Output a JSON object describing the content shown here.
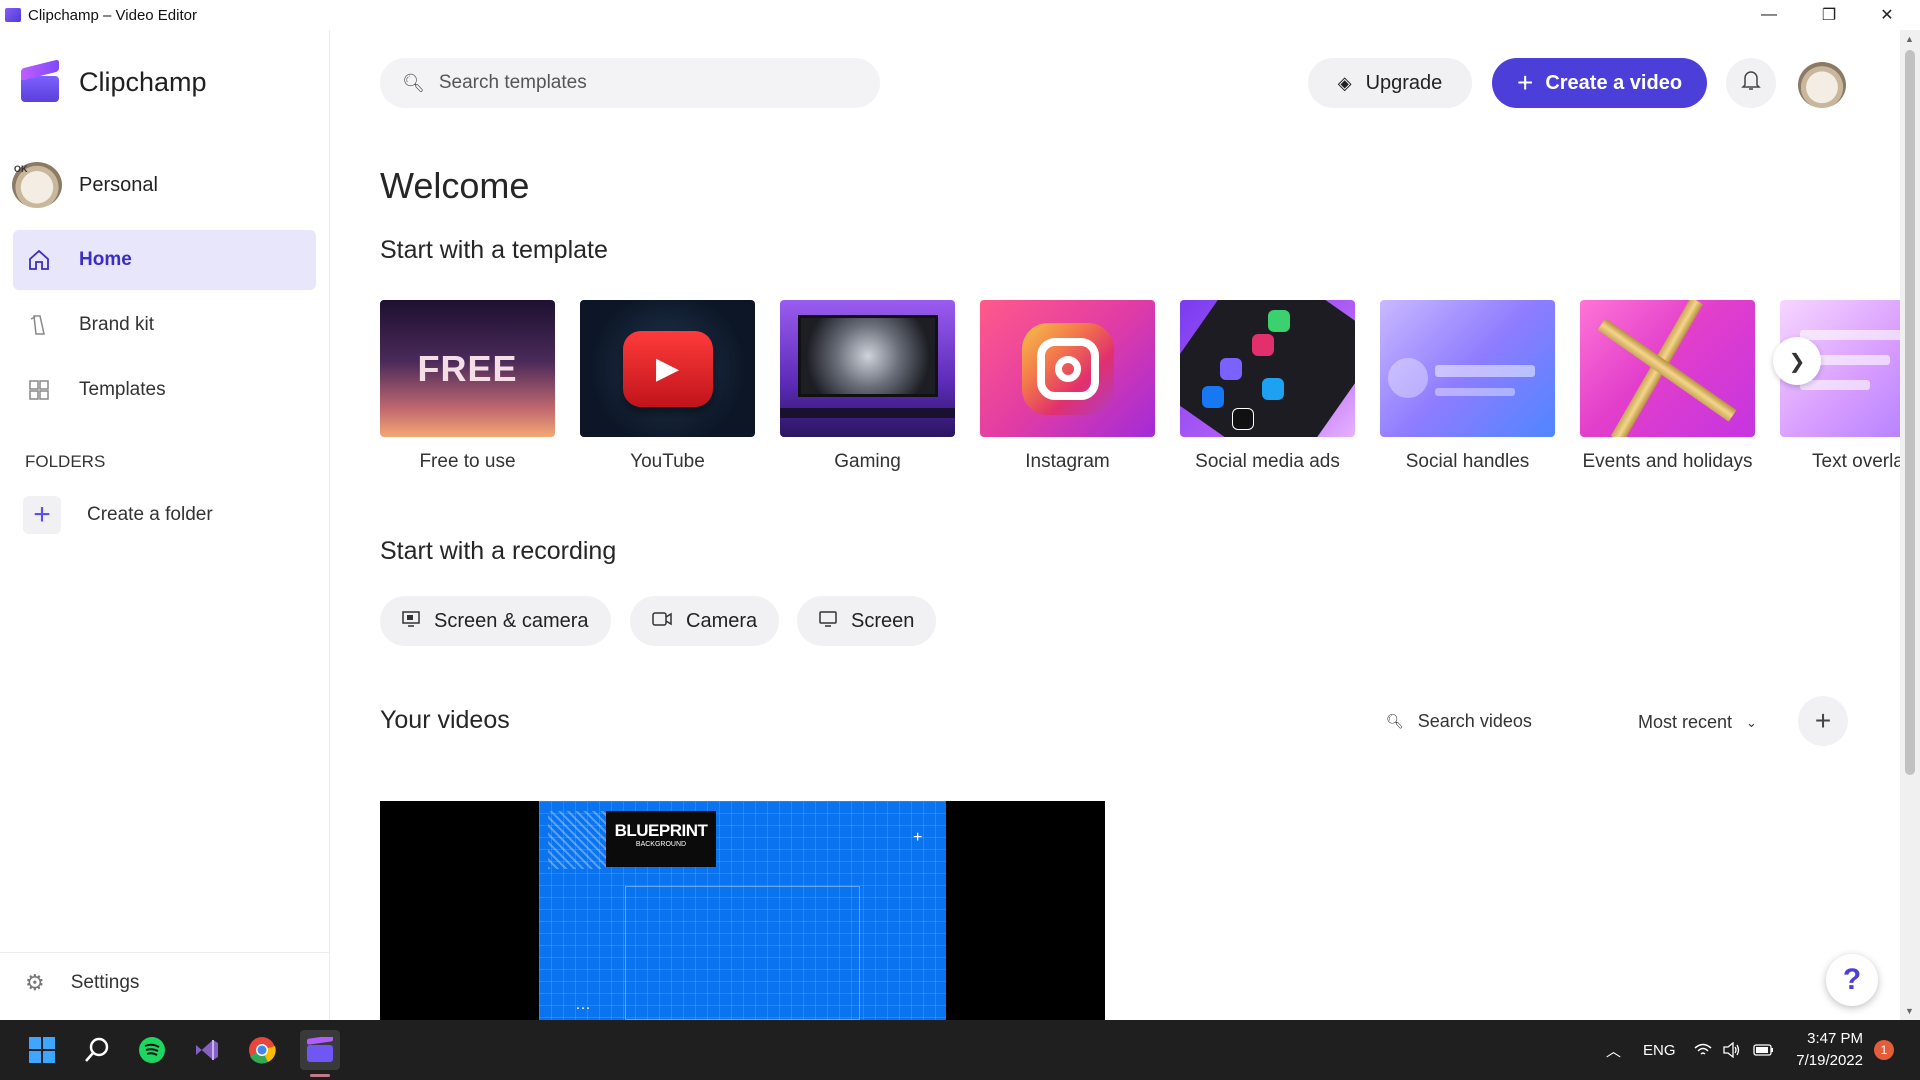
{
  "window": {
    "title": "Clipchamp – Video Editor",
    "minimize": "—",
    "restore": "❐",
    "close": "✕"
  },
  "sidebar": {
    "app_name": "Clipchamp",
    "profile_name": "Personal",
    "nav": [
      {
        "label": "Home",
        "icon": "home-icon",
        "active": true
      },
      {
        "label": "Brand kit",
        "icon": "brand-kit-icon",
        "active": false
      },
      {
        "label": "Templates",
        "icon": "templates-icon",
        "active": false
      }
    ],
    "folders_heading": "FOLDERS",
    "create_folder": "Create a folder",
    "settings": "Settings"
  },
  "header": {
    "search_placeholder": "Search templates",
    "upgrade": "Upgrade",
    "create_video": "Create a video"
  },
  "main": {
    "welcome": "Welcome",
    "templates_heading": "Start with a template",
    "templates": [
      {
        "label": "Free to use",
        "thumb_text": "FREE"
      },
      {
        "label": "YouTube"
      },
      {
        "label": "Gaming"
      },
      {
        "label": "Instagram"
      },
      {
        "label": "Social media ads"
      },
      {
        "label": "Social handles"
      },
      {
        "label": "Events and holidays"
      },
      {
        "label": "Text overla"
      }
    ],
    "recording_heading": "Start with a recording",
    "recording_options": [
      {
        "label": "Screen & camera",
        "icon": "screen-camera-icon"
      },
      {
        "label": "Camera",
        "icon": "camera-icon"
      },
      {
        "label": "Screen",
        "icon": "screen-icon"
      }
    ],
    "videos_heading": "Your videos",
    "videos_search_placeholder": "Search videos",
    "sort": "Most recent",
    "video_thumb_text_1": "BLUEPRINT",
    "video_thumb_text_2": "BACKGROUND"
  },
  "taskbar": {
    "apps": [
      "start-icon",
      "search-icon",
      "spotify-icon",
      "visual-studio-icon",
      "chrome-icon",
      "clipchamp-icon"
    ],
    "language": "ENG",
    "time": "3:47 PM",
    "date": "7/19/2022",
    "notification_count": "1"
  },
  "colors": {
    "accent": "#4b3ed9",
    "active_nav_bg": "#e8e6fb",
    "taskbar": "#1f1f1f"
  }
}
